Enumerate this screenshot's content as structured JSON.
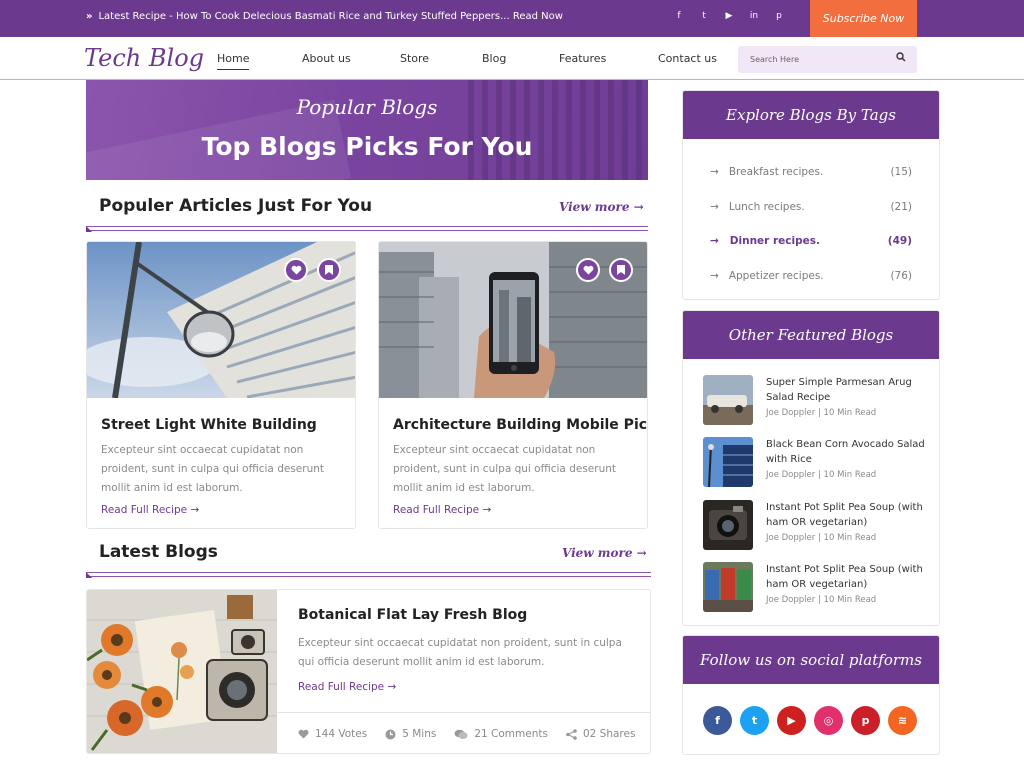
{
  "topbar": {
    "news": "Latest Recipe - How To Cook Delecious Basmati Rice and Turkey Stuffed Peppers... Read Now",
    "social_icons": [
      "facebook-icon",
      "twitter-icon",
      "youtube-icon",
      "linkedin-icon",
      "pinterest-icon"
    ],
    "subscribe_label": "Subscribe Now"
  },
  "header": {
    "logo": "Tech Blog",
    "nav": [
      "Home",
      "About us",
      "Store",
      "Blog",
      "Features",
      "Contact us"
    ],
    "active_nav": "Home",
    "search_placeholder": "Search Here"
  },
  "hero": {
    "subtitle": "Popular Blogs",
    "title": "Top Blogs Picks For You"
  },
  "popular": {
    "title": "Populer Articles Just For You",
    "view_more": "View more",
    "cards": [
      {
        "title": "Street Light White Building",
        "text": "Excepteur sint occaecat cupidatat non proident, sunt in culpa qui officia deserunt mollit anim id est laborum.",
        "read_more": "Read Full Recipe"
      },
      {
        "title": "Architecture Building Mobile Pic",
        "text": "Excepteur sint occaecat cupidatat non proident, sunt in culpa qui officia deserunt mollit anim id est laborum.",
        "read_more": "Read Full Recipe"
      }
    ]
  },
  "latest": {
    "title": "Latest Blogs",
    "view_more": "View more",
    "post": {
      "title": "Botanical Flat Lay Fresh Blog",
      "text": "Excepteur sint occaecat cupidatat non proident, sunt in culpa qui officia deserunt mollit anim id est laborum.",
      "read_more": "Read Full Recipe",
      "votes": "144 Votes",
      "time": "5 Mins",
      "comments": "21 Comments",
      "shares": "02 Shares"
    }
  },
  "sidebar": {
    "tags_title": "Explore Blogs By Tags",
    "tags": [
      {
        "label": "Breakfast recipes.",
        "count": "(15)"
      },
      {
        "label": "Lunch recipes.",
        "count": "(21)"
      },
      {
        "label": "Dinner recipes.",
        "count": "(49)"
      },
      {
        "label": "Appetizer recipes.",
        "count": "(76)"
      }
    ],
    "active_tag": "Dinner recipes.",
    "featured_title": "Other Featured Blogs",
    "featured": [
      {
        "title": "Super Simple Parmesan Arug Salad Recipe",
        "author": "Joe Doppler",
        "read": "10 Min Read"
      },
      {
        "title": "Black Bean Corn Avocado Salad with Rice",
        "author": "Joe Doppler",
        "read": "10 Min Read"
      },
      {
        "title": "Instant Pot Split Pea Soup (with ham OR vegetarian)",
        "author": "Joe Doppler",
        "read": "10 Min Read"
      },
      {
        "title": "Instant Pot Split Pea Soup (with ham OR vegetarian)",
        "author": "Joe Doppler",
        "read": "10 Min Read"
      }
    ],
    "social_title": "Follow us on social platforms",
    "social": [
      {
        "icon": "facebook-icon",
        "glyph": "f",
        "color": "#3b5998"
      },
      {
        "icon": "twitter-icon",
        "glyph": "t",
        "color": "#1da1f2"
      },
      {
        "icon": "youtube-icon",
        "glyph": "▶",
        "color": "#cd201f"
      },
      {
        "icon": "instagram-icon",
        "glyph": "◎",
        "color": "#e1306c"
      },
      {
        "icon": "pinterest-icon",
        "glyph": "p",
        "color": "#cb2027"
      },
      {
        "icon": "rss-icon",
        "glyph": "≋",
        "color": "#f26522"
      }
    ]
  },
  "colors": {
    "brand": "#6b3a8e",
    "accent": "#f36e3f"
  }
}
